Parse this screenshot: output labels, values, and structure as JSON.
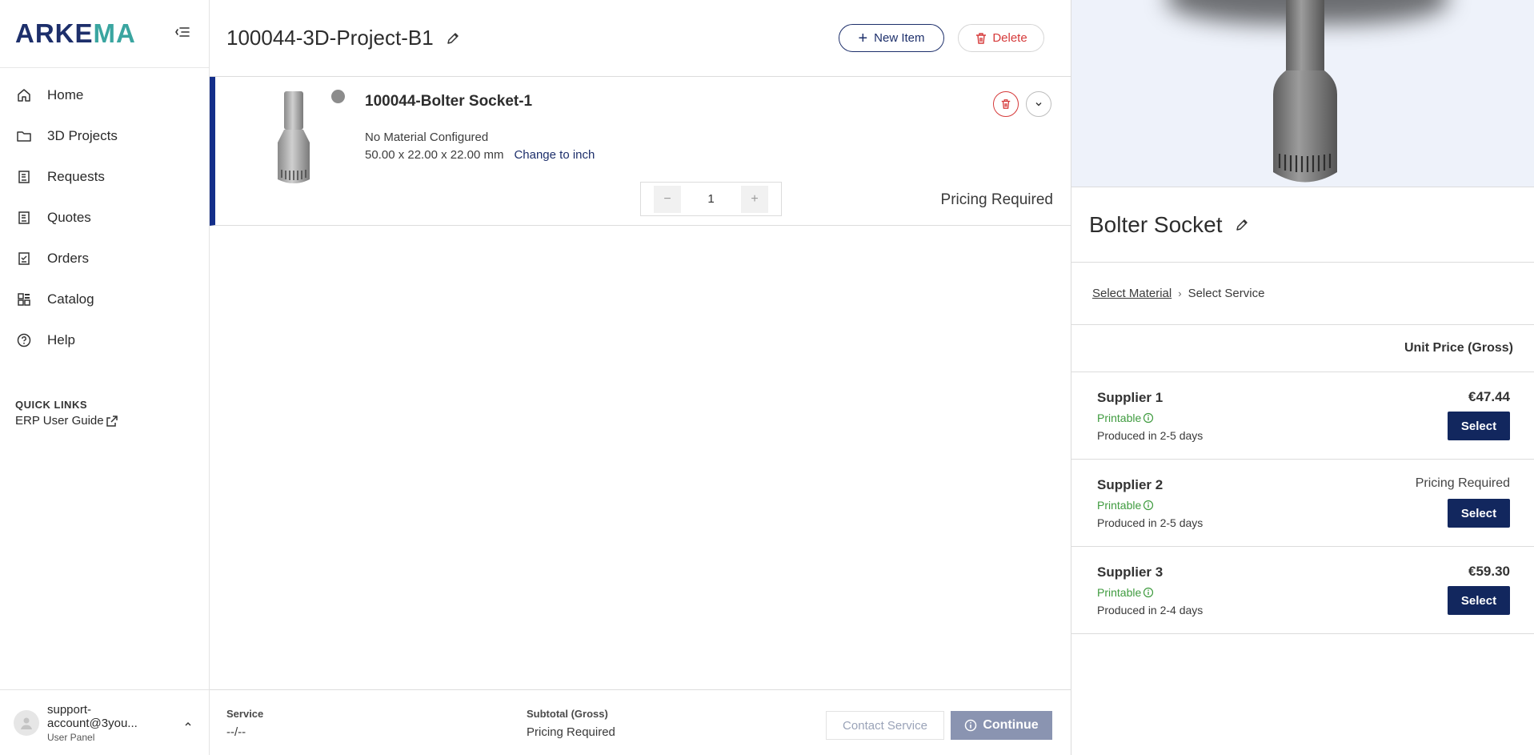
{
  "brand": {
    "part1": "ARKE",
    "part2": "MA"
  },
  "nav": [
    {
      "label": "Home",
      "icon": "home-icon"
    },
    {
      "label": "3D Projects",
      "icon": "folder-icon"
    },
    {
      "label": "Requests",
      "icon": "document-icon"
    },
    {
      "label": "Quotes",
      "icon": "document-icon"
    },
    {
      "label": "Orders",
      "icon": "checklist-icon"
    },
    {
      "label": "Catalog",
      "icon": "grid-icon"
    },
    {
      "label": "Help",
      "icon": "help-icon"
    }
  ],
  "quick_links": {
    "title": "QUICK LINKS",
    "item": "ERP User Guide"
  },
  "user": {
    "name": "support-account@3you...",
    "role": "User Panel"
  },
  "project": {
    "title": "100044-3D-Project-B1",
    "new_item": "New Item",
    "delete": "Delete"
  },
  "item": {
    "name": "100044-Bolter Socket-1",
    "material": "No Material Configured",
    "dims": "50.00 x 22.00 x 22.00 mm",
    "unit_link": "Change to inch",
    "quantity": "1",
    "pricing": "Pricing Required"
  },
  "footer": {
    "service_label": "Service",
    "service_value": "--/--",
    "subtotal_label": "Subtotal (Gross)",
    "subtotal_value": "Pricing Required",
    "contact": "Contact Service",
    "continue": "Continue"
  },
  "panel": {
    "part_title": "Bolter Socket",
    "breadcrumb": [
      "Select Material",
      "Select Service"
    ],
    "price_header": "Unit Price (Gross)",
    "suppliers": [
      {
        "name": "Supplier 1",
        "status": "Printable",
        "days": "Produced in 2-5 days",
        "price": "€47.44",
        "select": "Select"
      },
      {
        "name": "Supplier 2",
        "status": "Printable",
        "days": "Produced in 2-5 days",
        "price": "Pricing Required",
        "select": "Select"
      },
      {
        "name": "Supplier 3",
        "status": "Printable",
        "days": "Produced in 2-4 days",
        "price": "€59.30",
        "select": "Select"
      }
    ]
  },
  "colors": {
    "brand_navy": "#1d2f6b",
    "brand_teal": "#3aa5a0",
    "accent_bar": "#142f8a",
    "danger": "#d63a3a",
    "success": "#3f9b3f",
    "select_button": "#12275e"
  }
}
